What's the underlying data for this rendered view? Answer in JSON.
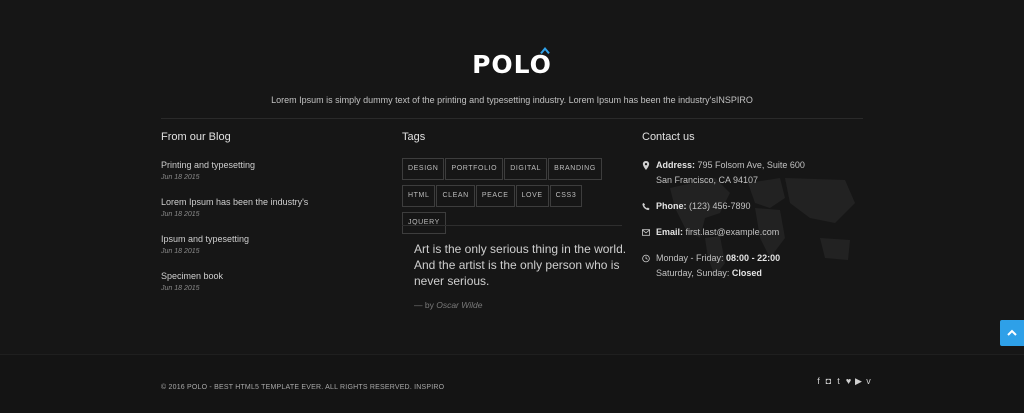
{
  "brand": {
    "logo": "POLO"
  },
  "tagline": "Lorem Ipsum is simply dummy text of the printing and typesetting industry. Lorem Ipsum has been the industry'sINSPIRO",
  "blog": {
    "title": "From our Blog",
    "items": [
      {
        "title": "Printing and typesetting",
        "date": "Jun 18 2015"
      },
      {
        "title": "Lorem Ipsum has been the industry's",
        "date": "Jun 18 2015"
      },
      {
        "title": "Ipsum and typesetting",
        "date": "Jun 18 2015"
      },
      {
        "title": "Specimen book",
        "date": "Jun 18 2015"
      }
    ]
  },
  "tags": {
    "title": "Tags",
    "items": [
      "Design",
      "Portfolio",
      "Digital",
      "Branding",
      "HTML",
      "Clean",
      "Peace",
      "Love",
      "CSS3",
      "jQuery"
    ]
  },
  "quote": {
    "text": "Art is the only serious thing in the world. And the artist is the only person who is never serious.",
    "by_prefix": "— by",
    "author": "Oscar Wilde"
  },
  "contact": {
    "title": "Contact us",
    "address_label": "Address:",
    "address_line1": "795 Folsom Ave, Suite 600",
    "address_line2": "San Francisco, CA 94107",
    "phone_label": "Phone:",
    "phone": "(123) 456-7890",
    "email_label": "Email:",
    "email": "first.last@example.com",
    "hours_line1_prefix": "Monday - Friday:",
    "hours_line1_value": "08:00 - 22:00",
    "hours_line2_prefix": "Saturday, Sunday:",
    "hours_line2_value": "Closed"
  },
  "copyright": "© 2016 POLO - BEST HTML5 TEMPLATE EVER. ALL RIGHTS RESERVED. INSPIRO",
  "social": [
    {
      "name": "facebook-icon",
      "glyph": "f"
    },
    {
      "name": "instagram-icon",
      "glyph": "◘"
    },
    {
      "name": "tumblr-icon",
      "glyph": "t"
    },
    {
      "name": "twitter-icon",
      "glyph": "♥"
    },
    {
      "name": "youtube-icon",
      "glyph": "▶"
    },
    {
      "name": "vimeo-icon",
      "glyph": "v"
    }
  ],
  "colors": {
    "accent": "#2ea0e8",
    "background": "#161616"
  },
  "icons": {
    "scroll_top": "chevron-up-icon",
    "address": "map-marker-icon",
    "phone": "phone-icon",
    "email": "envelope-icon",
    "hours": "clock-icon"
  }
}
